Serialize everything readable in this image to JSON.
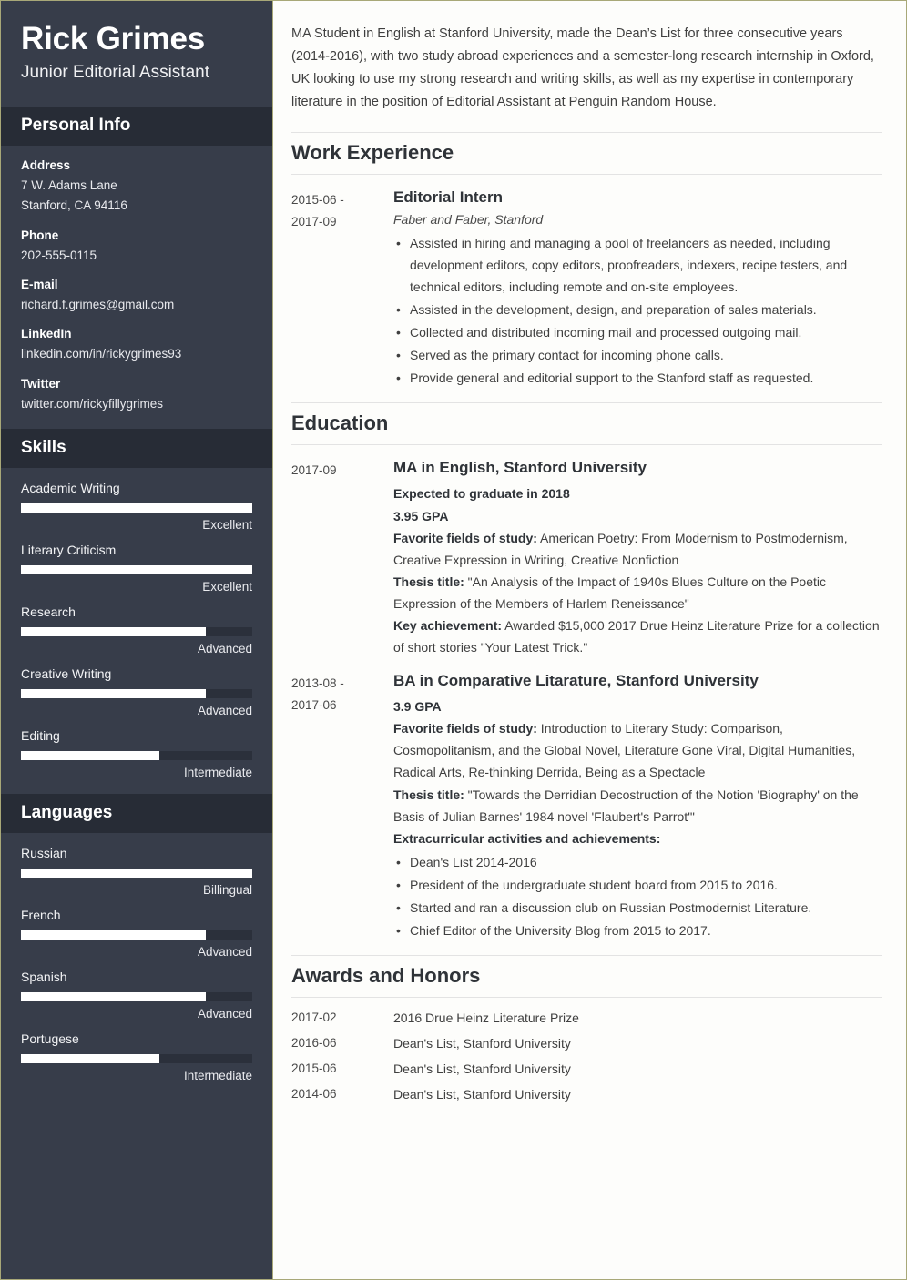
{
  "theme": {
    "sidebar_bg": "#373d4a",
    "sidebar_header_bg": "#272c36",
    "page_border": "#a8a878",
    "meter_fill": "#ffffff",
    "meter_track": "#2b303b",
    "main_bg": "#fdfdfb",
    "heading_color": "#2f3338"
  },
  "sidebar": {
    "full_name": "Rick Grimes",
    "job_title": "Junior Editorial Assistant",
    "personal_info": {
      "header": "Personal Info",
      "groups": [
        {
          "label": "Address",
          "lines": [
            "7 W. Adams Lane",
            "Stanford, CA 94116"
          ]
        },
        {
          "label": "Phone",
          "lines": [
            "202-555-0115"
          ]
        },
        {
          "label": "E-mail",
          "lines": [
            "richard.f.grimes@gmail.com"
          ]
        },
        {
          "label": "LinkedIn",
          "lines": [
            "linkedin.com/in/rickygrimes93"
          ]
        },
        {
          "label": "Twitter",
          "lines": [
            "twitter.com/rickyfillygrimes"
          ]
        }
      ]
    },
    "skills": {
      "header": "Skills",
      "items": [
        {
          "name": "Academic Writing",
          "level": "Excellent",
          "percent": 100
        },
        {
          "name": "Literary Criticism",
          "level": "Excellent",
          "percent": 100
        },
        {
          "name": "Research",
          "level": "Advanced",
          "percent": 80
        },
        {
          "name": "Creative Writing",
          "level": "Advanced",
          "percent": 80
        },
        {
          "name": "Editing",
          "level": "Intermediate",
          "percent": 60
        }
      ]
    },
    "languages": {
      "header": "Languages",
      "items": [
        {
          "name": "Russian",
          "level": "Billingual",
          "percent": 100
        },
        {
          "name": "French",
          "level": "Advanced",
          "percent": 80
        },
        {
          "name": "Spanish",
          "level": "Advanced",
          "percent": 80
        },
        {
          "name": "Portugese",
          "level": "Intermediate",
          "percent": 60
        }
      ]
    }
  },
  "main": {
    "summary": "MA Student in English at Stanford University, made the Dean’s List for three consecutive years (2014-2016), with two study abroad experiences and a semester-long research internship in Oxford, UK looking to use my strong research and writing skills, as well as my expertise in contemporary literature in the position of Editorial Assistant at Penguin Random House.",
    "work_experience": {
      "title": "Work Experience",
      "entries": [
        {
          "date": "2015-06 - 2017-09",
          "date_line1": "2015-06 -",
          "date_line2": "2017-09",
          "role": "Editorial Intern",
          "company": "Faber and Faber, Stanford",
          "bullets": [
            "Assisted in hiring and managing a pool of freelancers as needed, including development editors, copy editors, proofreaders, indexers, recipe testers, and technical editors, including remote and on-site employees.",
            "Assisted in the development, design, and preparation of sales materials.",
            "Collected and distributed incoming mail and processed outgoing mail.",
            "Served as the primary contact for incoming phone calls.",
            "Provide general and editorial support to the Stanford staff as requested."
          ]
        }
      ]
    },
    "education": {
      "title": "Education",
      "entries": [
        {
          "date_line1": "2017-09",
          "date_line2": "",
          "degree": "MA in English, Stanford University",
          "graduation": "Expected to graduate in 2018",
          "gpa": "3.95 GPA",
          "fields_label": "Favorite fields of study:",
          "fields_value": " American Poetry: From Modernism to Postmodernism, Creative Expression in Writing, Creative Nonfiction",
          "thesis_label": "Thesis title:",
          "thesis_value": " \"An Analysis of the Impact of 1940s Blues Culture on the Poetic Expression of the Members of Harlem Reneissance\"",
          "achievement_label": "Key achievement:",
          "achievement_value": " Awarded $15,000 2017 Drue Heinz Literature Prize for a collection of short stories \"Your Latest Trick.\""
        },
        {
          "date_line1": "2013-08 -",
          "date_line2": "2017-06",
          "degree": "BA in Comparative Litarature, Stanford University",
          "gpa": "3.9 GPA",
          "fields_label": "Favorite fields of study:",
          "fields_value": " Introduction to Literary Study: Comparison, Cosmopolitanism, and the Global Novel, Literature Gone Viral, Digital Humanities, Radical Arts, Re-thinking Derrida, Being as a Spectacle",
          "thesis_label": "Thesis title:",
          "thesis_value": " \"Towards the Derridian Decostruction of the Notion 'Biography' on the Basis of Julian Barnes' 1984 novel 'Flaubert's Parrot'\"",
          "extracurricular_label": "Extracurricular activities and achievements:",
          "bullets": [
            "Dean's List 2014-2016",
            "President of the undergraduate student board from 2015 to 2016.",
            "Started and ran a discussion club on Russian Postmodernist Literature.",
            "Chief Editor of the University Blog from 2015 to 2017."
          ]
        }
      ]
    },
    "awards": {
      "title": "Awards and Honors",
      "rows": [
        {
          "date": "2017-02",
          "text": "2016 Drue Heinz Literature Prize"
        },
        {
          "date": "2016-06",
          "text": "Dean's List, Stanford University"
        },
        {
          "date": "2015-06",
          "text": "Dean's List, Stanford University"
        },
        {
          "date": "2014-06",
          "text": "Dean's List, Stanford University"
        }
      ]
    }
  }
}
